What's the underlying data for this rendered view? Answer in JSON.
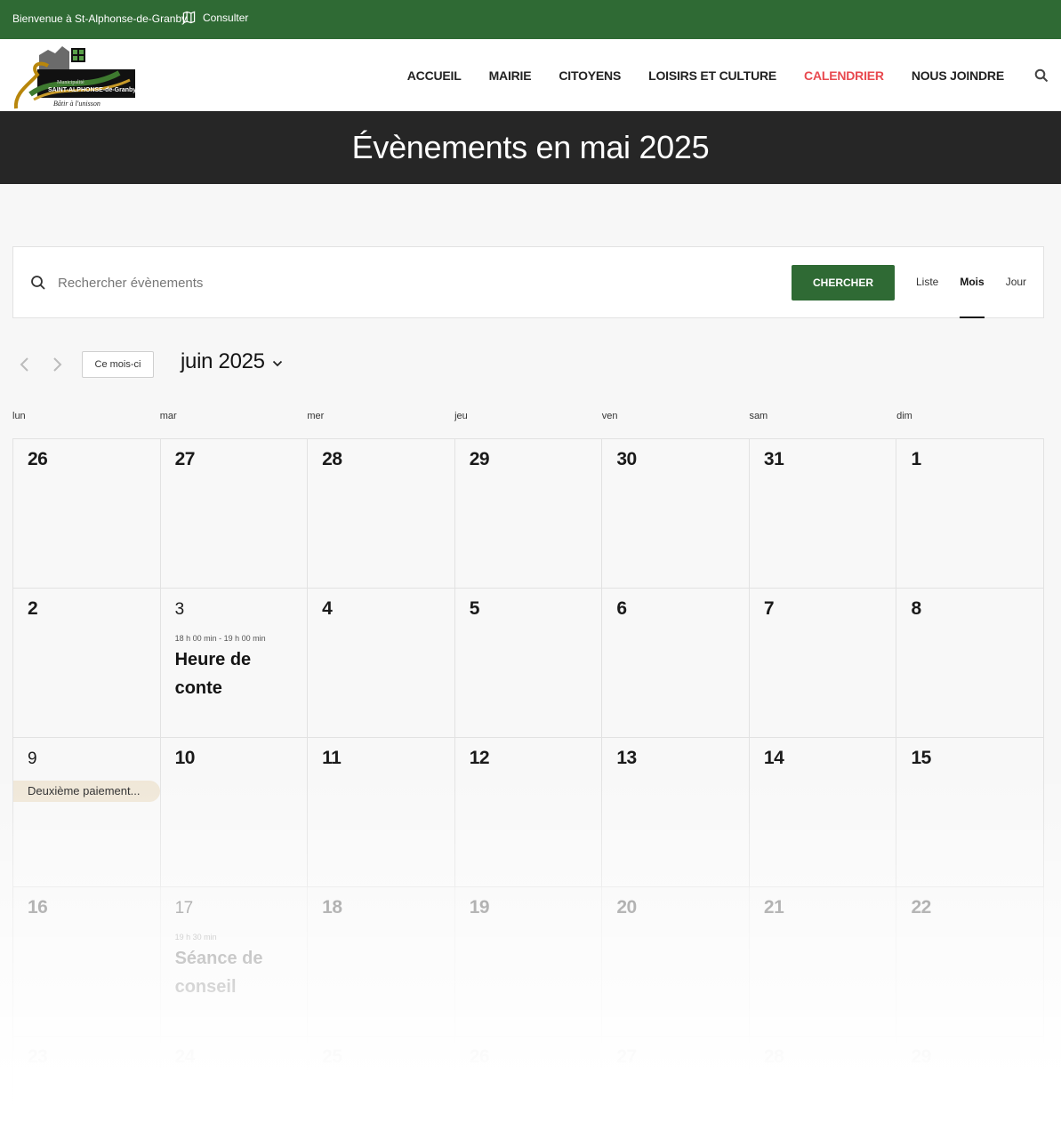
{
  "topbar": {
    "welcome": "Bienvenue à St-Alphonse-de-Granby",
    "consult_label": "Consulter"
  },
  "logo": {
    "line1": "Municipalité",
    "line2": "SAINT-ALPHONSE-de-Granby",
    "tagline": "Bâtir à l'unisson"
  },
  "nav": {
    "items": [
      {
        "label": "ACCUEIL",
        "active": false
      },
      {
        "label": "MAIRIE",
        "active": false
      },
      {
        "label": "CITOYENS",
        "active": false
      },
      {
        "label": "LOISIRS ET CULTURE",
        "active": false
      },
      {
        "label": "CALENDRIER",
        "active": true
      },
      {
        "label": "NOUS JOINDRE",
        "active": false
      }
    ]
  },
  "hero": {
    "title": "Évènements en mai 2025"
  },
  "search": {
    "placeholder": "Rechercher évènements",
    "button": "CHERCHER",
    "views": [
      "Liste",
      "Mois",
      "Jour"
    ],
    "selected_view": "Mois"
  },
  "month_nav": {
    "today_label": "Ce mois-ci",
    "current": "juin 2025"
  },
  "weekdays": [
    "lun",
    "mar",
    "mer",
    "jeu",
    "ven",
    "sam",
    "dim"
  ],
  "weeks": [
    [
      {
        "day": "26"
      },
      {
        "day": "27"
      },
      {
        "day": "28"
      },
      {
        "day": "29"
      },
      {
        "day": "30"
      },
      {
        "day": "31"
      },
      {
        "day": "1"
      }
    ],
    [
      {
        "day": "2"
      },
      {
        "day": "3",
        "time": "18 h 00 min - 19 h 00 min",
        "title": "Heure de conte"
      },
      {
        "day": "4"
      },
      {
        "day": "5"
      },
      {
        "day": "6"
      },
      {
        "day": "7"
      },
      {
        "day": "8"
      }
    ],
    [
      {
        "day": "9",
        "bar": "Deuxième paiement..."
      },
      {
        "day": "10"
      },
      {
        "day": "11"
      },
      {
        "day": "12"
      },
      {
        "day": "13"
      },
      {
        "day": "14"
      },
      {
        "day": "15"
      }
    ],
    [
      {
        "day": "16"
      },
      {
        "day": "17",
        "time": "19 h 30 min",
        "title": "Séance de conseil"
      },
      {
        "day": "18"
      },
      {
        "day": "19"
      },
      {
        "day": "20"
      },
      {
        "day": "21"
      },
      {
        "day": "22"
      }
    ],
    [
      {
        "day": "23"
      },
      {
        "day": "24"
      },
      {
        "day": "25"
      },
      {
        "day": "26"
      },
      {
        "day": "27"
      },
      {
        "day": "28"
      },
      {
        "day": "29"
      }
    ]
  ],
  "colors": {
    "brand_green": "#2f6a34",
    "active_nav": "#e8494f",
    "hero_bg": "#262626",
    "multiday_bar": "#efe6d6"
  }
}
